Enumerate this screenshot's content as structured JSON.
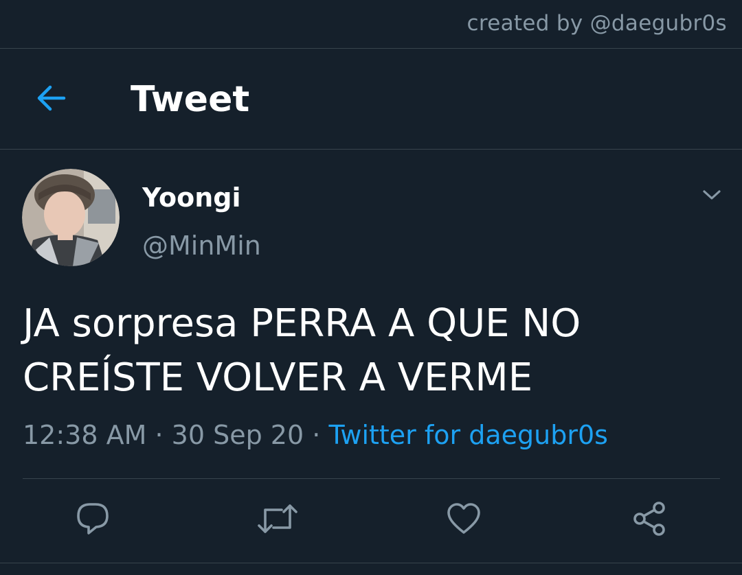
{
  "watermark": "created by @daegubr0s",
  "header": {
    "title": "Tweet",
    "back_icon": "arrow-left-icon"
  },
  "tweet": {
    "display_name": "Yoongi",
    "handle": "@MinMin",
    "text": "JA sorpresa PERRA A QUE NO CREÍSTE VOLVER A VERME",
    "time": "12:38 AM",
    "date": "30 Sep 20",
    "separator": "·",
    "source": "Twitter for daegubr0s"
  },
  "actions": [
    "reply-icon",
    "retweet-icon",
    "like-icon",
    "share-icon"
  ],
  "colors": {
    "background": "#15202b",
    "accent": "#1da1f2",
    "muted": "#8899a6",
    "divider": "#38444d"
  }
}
